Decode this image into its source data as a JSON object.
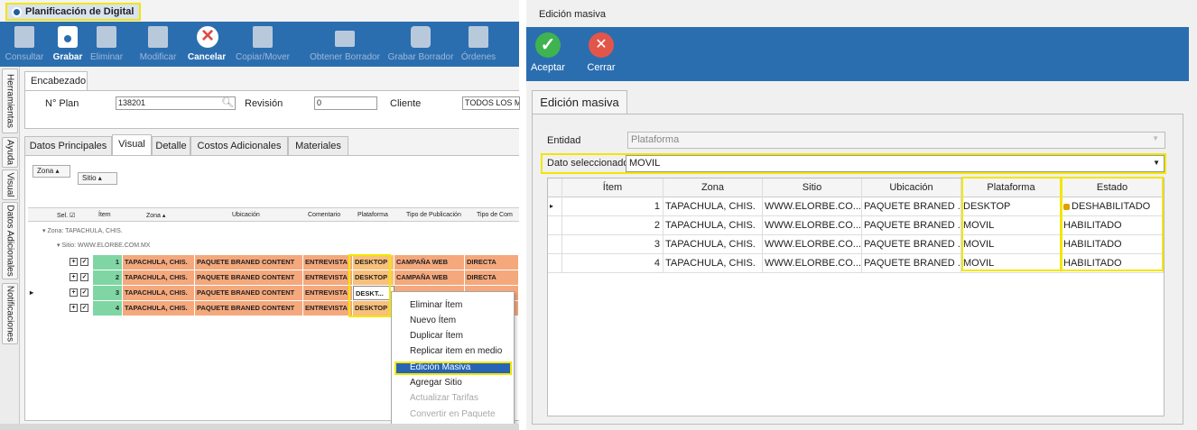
{
  "left": {
    "doc_tab": "Planificación de Digital",
    "ribbon": [
      {
        "label": "Consultar",
        "icon": "search-doc-icon",
        "active": false
      },
      {
        "label": "Grabar",
        "icon": "save-icon",
        "active": true
      },
      {
        "label": "Eliminar",
        "icon": "delete-doc-icon",
        "active": false
      },
      {
        "label": "Modificar",
        "icon": "edit-icon",
        "active": false
      },
      {
        "label": "Cancelar",
        "icon": "cancel-icon",
        "active": true
      },
      {
        "label": "Copiar/Mover",
        "icon": "copy-icon",
        "active": false
      },
      {
        "label": "Obtener Borrador",
        "icon": "folder-icon",
        "active": false
      },
      {
        "label": "Grabar Borrador",
        "icon": "save-draft-icon",
        "active": false
      },
      {
        "label": "Órdenes",
        "icon": "orders-icon",
        "active": false
      }
    ],
    "side_tabs": [
      "Herramientas",
      "Ayuda",
      "Visual",
      "Datos Adicionales",
      "Notificaciones"
    ],
    "header": {
      "tab": "Encabezado",
      "plan_label": "N° Plan",
      "plan_value": "138201",
      "revision_label": "Revisión",
      "revision_value": "0",
      "cliente_label": "Cliente",
      "cliente_value": "TODOS LOS ME"
    },
    "tabs": [
      "Datos Principales",
      "Visual",
      "Detalle",
      "Costos Adicionales",
      "Materiales"
    ],
    "group_buttons": [
      "Zona",
      "Sitio"
    ],
    "columns": [
      "Sel.",
      "Ítem",
      "Zona",
      "Ubicación",
      "Comentario",
      "Plataforma",
      "Tipo de Publicación",
      "Tipo de Com"
    ],
    "group_zone": "Zona: TAPACHULA, CHIS.",
    "group_site": "Sitio: WWW.ELORBE.COM.MX",
    "rows": [
      {
        "item": "1",
        "zona": "TAPACHULA, CHIS.",
        "ubicacion": "PAQUETE BRANED CONTENT",
        "comentario": "ENTREVISTA",
        "plataforma": "DESKTOP",
        "tipo_pub": "CAMPAÑA WEB",
        "tipo_com": "DIRECTA"
      },
      {
        "item": "2",
        "zona": "TAPACHULA, CHIS.",
        "ubicacion": "PAQUETE BRANED CONTENT",
        "comentario": "ENTREVISTA",
        "plataforma": "DESKTOP",
        "tipo_pub": "CAMPAÑA WEB",
        "tipo_com": "DIRECTA"
      },
      {
        "item": "3",
        "zona": "TAPACHULA, CHIS.",
        "ubicacion": "PAQUETE BRANED CONTENT",
        "comentario": "ENTREVISTA",
        "plataforma": "DESKT...",
        "tipo_pub": "",
        "tipo_com": ""
      },
      {
        "item": "4",
        "zona": "TAPACHULA, CHIS.",
        "ubicacion": "PAQUETE BRANED CONTENT",
        "comentario": "ENTREVISTA",
        "plataforma": "DESKTOP",
        "tipo_pub": "",
        "tipo_com": ""
      }
    ],
    "context_menu": [
      {
        "label": "Eliminar Ítem",
        "enabled": true
      },
      {
        "label": "Nuevo Ítem",
        "enabled": true
      },
      {
        "label": "Duplicar Ítem",
        "enabled": true
      },
      {
        "label": "Replicar item en medio",
        "enabled": true
      },
      {
        "label": "Edición Masiva",
        "enabled": true,
        "selected": true
      },
      {
        "label": "Agregar Sitio",
        "enabled": true
      },
      {
        "label": "Actualizar Tarifas",
        "enabled": false
      },
      {
        "label": "Convertir en Paquete",
        "enabled": false
      }
    ]
  },
  "dialog": {
    "title": "Edición masiva",
    "buttons": [
      "Aceptar",
      "Cerrar"
    ],
    "tab": "Edición masiva",
    "entidad_label": "Entidad",
    "entidad_value": "Plataforma",
    "dato_label": "Dato seleccionado",
    "dato_value": "MOVIL",
    "columns": [
      "Ítem",
      "Zona",
      "Sitio",
      "Ubicación",
      "Plataforma",
      "Estado"
    ],
    "rows": [
      {
        "item": "1",
        "zona": "TAPACHULA, CHIS.",
        "sitio": "WWW.ELORBE.CO...",
        "ubicacion": "PAQUETE BRANED ...",
        "plataforma": "DESKTOP",
        "estado": "DESHABILITADO",
        "locked": true
      },
      {
        "item": "2",
        "zona": "TAPACHULA, CHIS.",
        "sitio": "WWW.ELORBE.CO...",
        "ubicacion": "PAQUETE BRANED ...",
        "plataforma": "MOVIL",
        "estado": "HABILITADO",
        "locked": false
      },
      {
        "item": "3",
        "zona": "TAPACHULA, CHIS.",
        "sitio": "WWW.ELORBE.CO...",
        "ubicacion": "PAQUETE BRANED ...",
        "plataforma": "MOVIL",
        "estado": "HABILITADO",
        "locked": false
      },
      {
        "item": "4",
        "zona": "TAPACHULA, CHIS.",
        "sitio": "WWW.ELORBE.CO...",
        "ubicacion": "PAQUETE BRANED ...",
        "plataforma": "MOVIL",
        "estado": "HABILITADO",
        "locked": false
      }
    ]
  },
  "colors": {
    "ribbon": "#2b6eb0",
    "highlight": "#f2e600",
    "row_fill": "#f4a87c",
    "item_fill": "#7fd6a4",
    "selected_menu": "#2864b4"
  }
}
